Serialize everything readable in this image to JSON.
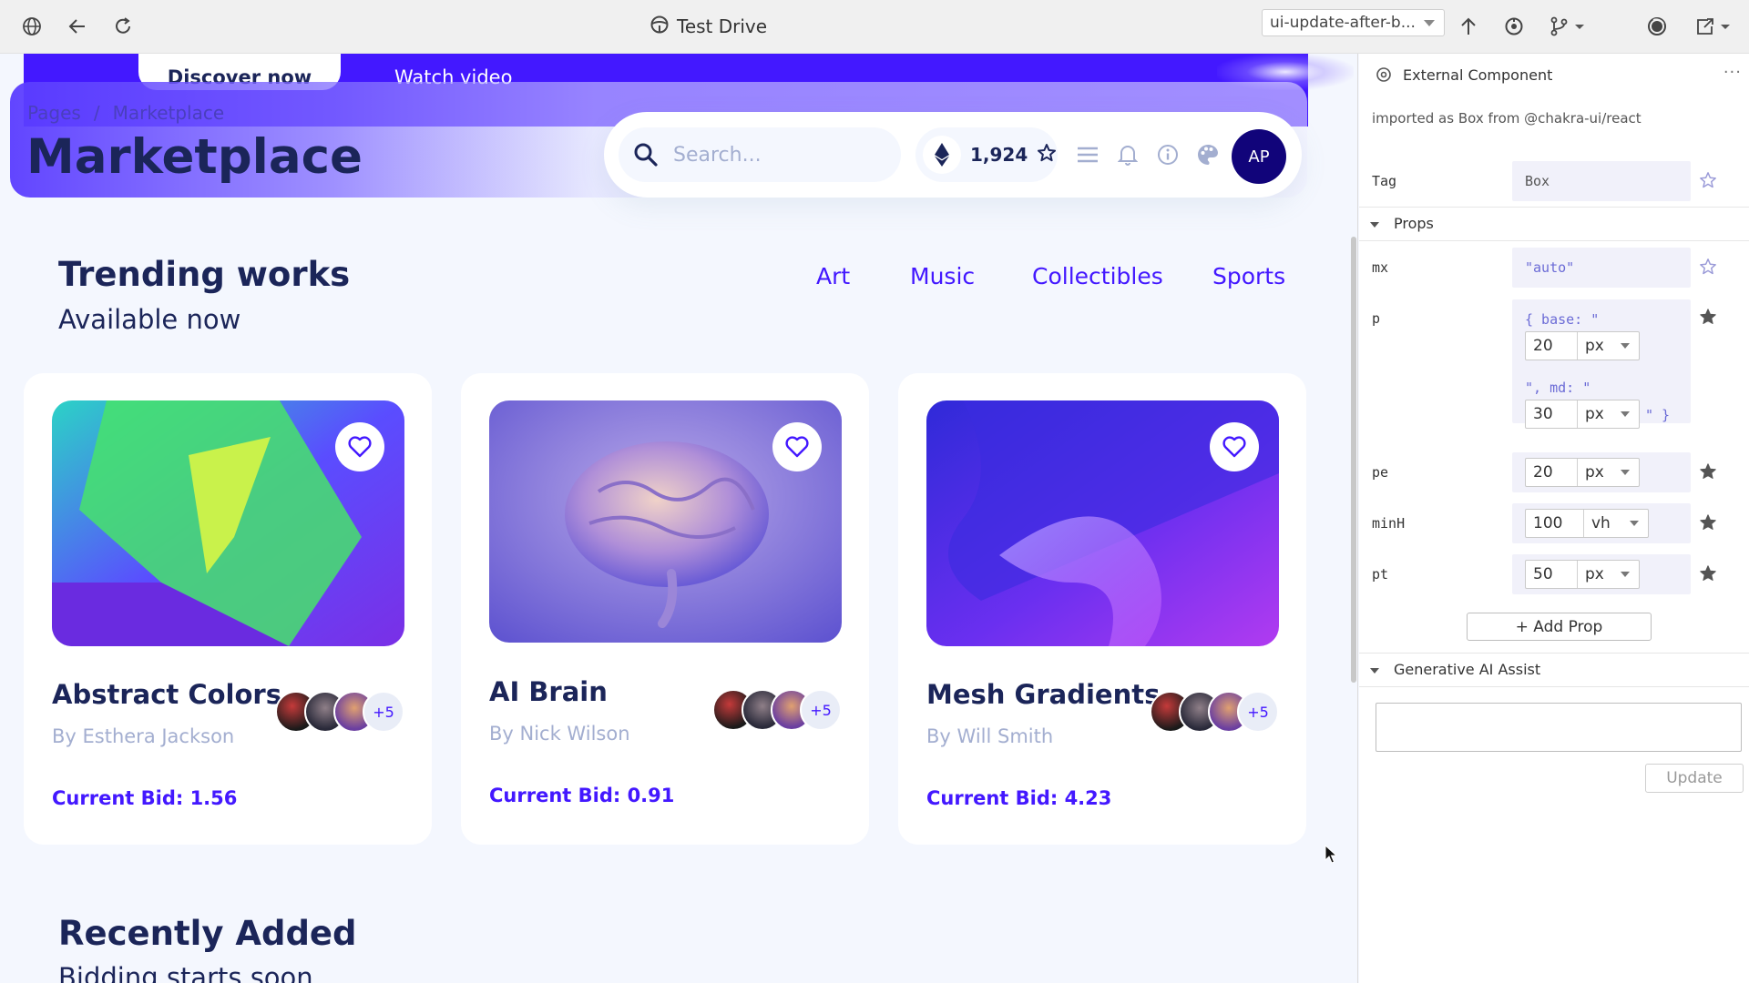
{
  "browser": {
    "title": "Test Drive",
    "branch": "ui-update-after-b..."
  },
  "hero": {
    "primary_button": "Discover now",
    "secondary_link": "Watch video"
  },
  "navbar": {
    "breadcrumb_root": "Pages",
    "breadcrumb_sep": "/",
    "breadcrumb_current": "Marketplace",
    "title": "Marketplace",
    "search_placeholder": "Search...",
    "credits": "1,924",
    "avatar_initials": "AP"
  },
  "trending": {
    "title": "Trending works",
    "subtitle": "Available now",
    "categories": [
      "Art",
      "Music",
      "Collectibles",
      "Sports"
    ]
  },
  "cards": [
    {
      "title": "Abstract Colors",
      "author": "By Esthera Jackson",
      "bid": "Current Bid: 1.56",
      "more_bidders": "+5"
    },
    {
      "title": "AI Brain",
      "author": "By Nick Wilson",
      "bid": "Current Bid: 0.91",
      "more_bidders": "+5"
    },
    {
      "title": "Mesh Gradients",
      "author": "By Will Smith",
      "bid": "Current Bid: 4.23",
      "more_bidders": "+5"
    }
  ],
  "recent": {
    "title": "Recently Added",
    "subtitle": "Bidding starts soon"
  },
  "panel": {
    "header": "External Component",
    "more": "···",
    "imported": "imported as Box from @chakra-ui/react",
    "tag_label": "Tag",
    "tag_value": "Box",
    "props_section": "Props",
    "props": {
      "mx": {
        "label": "mx",
        "value": "\"auto\""
      },
      "p": {
        "label": "p",
        "open": "{ base: \"",
        "base_value": "20",
        "base_unit": "px",
        "md_text": "\", md: \"",
        "md_value": "30",
        "md_unit": "px",
        "close": "\" }"
      },
      "pe": {
        "label": "pe",
        "value": "20",
        "unit": "px"
      },
      "minH": {
        "label": "minH",
        "value": "100",
        "unit": "vh"
      },
      "pt": {
        "label": "pt",
        "value": "50",
        "unit": "px"
      }
    },
    "add_prop": "+ Add Prop",
    "ai_section": "Generative AI Assist",
    "update": "Update"
  },
  "colors": {
    "brand": "#4318ff",
    "navy": "#1b2559",
    "muted": "#a3aed0",
    "avatar_bg": "#11047a"
  }
}
